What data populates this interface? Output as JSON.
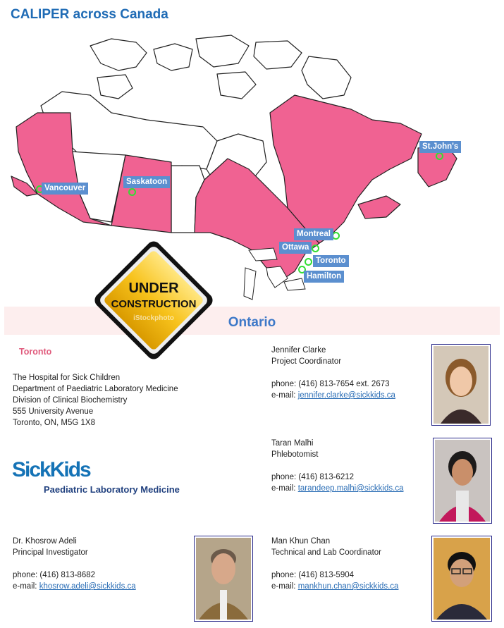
{
  "page_title": "CALIPER across Canada",
  "map": {
    "cities": [
      {
        "name": "Vancouver"
      },
      {
        "name": "Saskatoon"
      },
      {
        "name": "St.John's"
      },
      {
        "name": "Montreal"
      },
      {
        "name": "Ottawa"
      },
      {
        "name": "Toronto"
      },
      {
        "name": "Hamilton"
      }
    ],
    "colors": {
      "highlight": "#f06292",
      "outline": "#222222",
      "label_bg": "#5b8fcf"
    }
  },
  "construction_sign": {
    "line1": "UNDER",
    "line2": "CONSTRUCTION",
    "watermark": "iStockphoto"
  },
  "province": "Ontario",
  "site": {
    "city": "Toronto",
    "address": [
      "The Hospital for Sick Children",
      "Department of Paediatric Laboratory Medicine",
      "Division of Clinical Biochemistry",
      "555 University Avenue",
      "Toronto, ON, M5G 1X8"
    ],
    "logo_main": "SickKids",
    "logo_sub": "Paediatric Laboratory Medicine"
  },
  "people": [
    {
      "name": "Jennifer Clarke",
      "role": "Project Coordinator",
      "phone": "phone: (416) 813-7654 ext. 2673",
      "email_label": "e-mail:",
      "email": "jennifer.clarke@sickkids.ca"
    },
    {
      "name": "Taran Malhi",
      "role": "Phlebotomist",
      "phone": "phone: (416) 813-6212",
      "email_label": "e-mail:",
      "email": "tarandeep.malhi@sickkids.ca"
    },
    {
      "name": "Dr. Khosrow Adeli",
      "role": "Principal Investigator",
      "phone": "phone: (416) 813-8682",
      "email_label": "e-mail:",
      "email": "khosrow.adeli@sickkids.ca"
    },
    {
      "name": "Man Khun Chan",
      "role": "Technical and Lab Coordinator",
      "phone": "phone: (416) 813-5904",
      "email_label": "e-mail:",
      "email": "mankhun.chan@sickkids.ca"
    }
  ]
}
